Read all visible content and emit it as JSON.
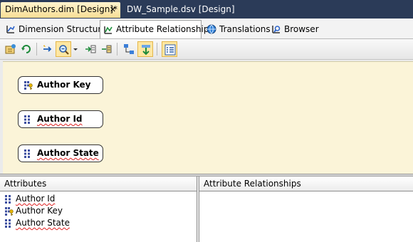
{
  "document_tabs": [
    {
      "label": "DimAuthors.dim [Design]*",
      "active": true,
      "close_glyph": "✕"
    },
    {
      "label": "DW_Sample.dsv [Design]",
      "active": false
    }
  ],
  "sub_tabs": [
    {
      "label": "Dimension Structure",
      "icon": "dimension-structure-icon"
    },
    {
      "label": "Attribute Relationships",
      "icon": "attribute-relationships-icon",
      "selected": true
    },
    {
      "label": "Translations",
      "icon": "translations-icon"
    },
    {
      "label": "Browser",
      "icon": "browser-icon"
    }
  ],
  "toolbar": {
    "buttons": [
      "process-icon",
      "refresh-icon",
      "new-relationship-icon",
      "zoom-icon",
      "zoom-dropdown-icon",
      "expand-icon",
      "collapse-icon",
      "arrange-icon",
      "move-down-icon",
      "show-list-icon"
    ]
  },
  "diagram": {
    "nodes": [
      {
        "label": "Author Key",
        "icon": "key-attribute-icon"
      },
      {
        "label": "Author Id",
        "icon": "attribute-icon"
      },
      {
        "label": "Author State",
        "icon": "attribute-icon"
      }
    ]
  },
  "attributes_pane": {
    "title": "Attributes",
    "items": [
      {
        "label": "Author Id",
        "icon": "attribute-icon"
      },
      {
        "label": "Author Key",
        "icon": "key-attribute-icon"
      },
      {
        "label": "Author State",
        "icon": "attribute-icon"
      }
    ]
  },
  "relationships_pane": {
    "title": "Attribute Relationships"
  },
  "colors": {
    "shell": "#2b3b58",
    "active_tab": "#f8de95",
    "canvas": "#fbf4d8",
    "pressed_button": "#ffe7a2"
  }
}
